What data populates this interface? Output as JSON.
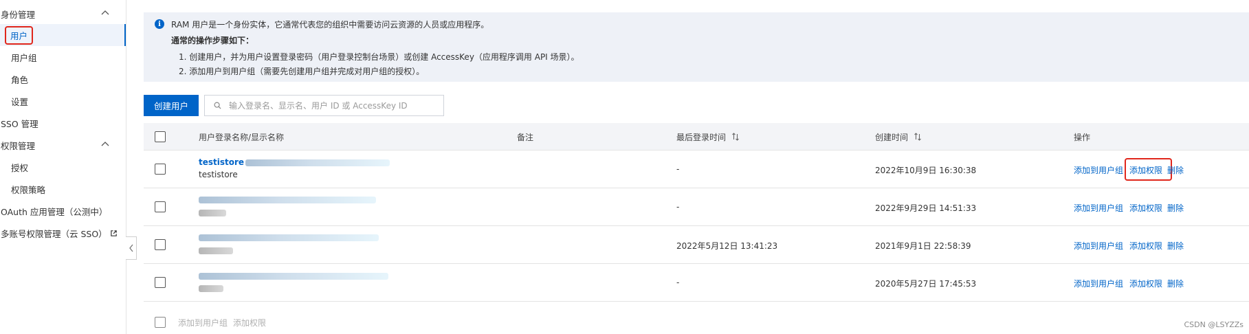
{
  "sidebar": {
    "identity_group": "身份管理",
    "items": [
      "用户",
      "用户组",
      "角色",
      "设置"
    ],
    "sso": "SSO 管理",
    "permission_group": "权限管理",
    "permission_items": [
      "授权",
      "权限策略"
    ],
    "oauth": "OAuth 应用管理（公测中）",
    "multi_account": "多账号权限管理（云 SSO）"
  },
  "info": {
    "intro": "RAM 用户是一个身份实体，它通常代表您的组织中需要访问云资源的人员或应用程序。",
    "steps_title": "通常的操作步骤如下：",
    "step1": "1. 创建用户，并为用户设置登录密码（用户登录控制台场景）或创建 AccessKey（应用程序调用 API 场景）。",
    "step2": "2. 添加用户到用户组（需要先创建用户组并完成对用户组的授权）。"
  },
  "toolbar": {
    "create_user": "创建用户",
    "search_placeholder": "输入登录名、显示名、用户 ID 或 AccessKey ID"
  },
  "table": {
    "columns": [
      "用户登录名称/显示名称",
      "备注",
      "最后登录时间",
      "创建时间",
      "操作"
    ],
    "rows": [
      {
        "login": "testistore",
        "display": "testistore",
        "last_login": "-",
        "created": "2022年10月9日 16:30:38"
      },
      {
        "login": "",
        "display": "",
        "last_login": "-",
        "created": "2022年9月29日 14:51:33"
      },
      {
        "login": "",
        "display": "",
        "last_login": "2022年5月12日 13:41:23",
        "created": "2021年9月1日 22:58:39"
      },
      {
        "login": "",
        "display": "",
        "last_login": "-",
        "created": "2020年5月27日 17:45:53"
      }
    ],
    "actions": [
      "添加到用户组",
      "添加权限",
      "删除"
    ],
    "footer_actions": [
      "添加到用户组",
      "添加权限"
    ]
  },
  "watermark": "CSDN @LSYZZs",
  "colors": {
    "accent": "#0064c8",
    "highlight": "#e0261b",
    "banner": "#eef1f7"
  }
}
